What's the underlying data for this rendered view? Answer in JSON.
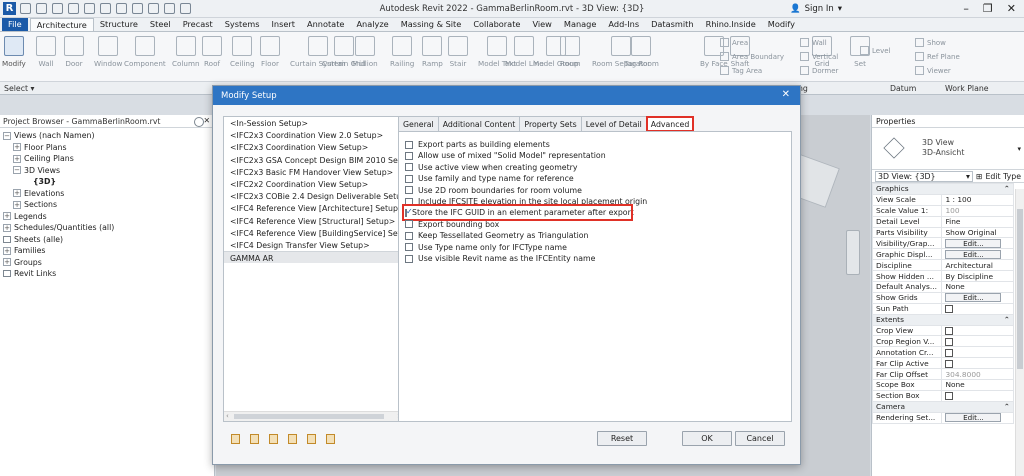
{
  "app": {
    "title": "Autodesk Revit 2022 - GammaBerlinRoom.rvt - 3D View: {3D}",
    "logo_letter": "R",
    "sign_in": "Sign In"
  },
  "ribbon": {
    "tabs": [
      "File",
      "Architecture",
      "Structure",
      "Steel",
      "Precast",
      "Systems",
      "Insert",
      "Annotate",
      "Analyze",
      "Massing & Site",
      "Collaborate",
      "View",
      "Manage",
      "Add-Ins",
      "Datasmith",
      "Rhino.Inside",
      "Modify"
    ],
    "active_tab": "Architecture",
    "buttons": [
      "Modify",
      "Wall",
      "Door",
      "Window",
      "Component",
      "Column",
      "Roof",
      "Ceiling",
      "Floor",
      "Curtain System",
      "Curtain Grid",
      "Mullion",
      "Railing",
      "Ramp",
      "Stair",
      "Model Text",
      "Model Line",
      "Model Group",
      "Room",
      "Room Separator",
      "Tag Room",
      "By Face",
      "Shaft",
      "Grid",
      "Set"
    ],
    "small_buttons": [
      "Area",
      "Area Boundary",
      "Tag Area",
      "Wall",
      "Vertical",
      "Dormer",
      "Level",
      "Show",
      "Ref Plane",
      "Viewer"
    ],
    "panel_labels": {
      "select": "Select ▾",
      "opening": "Opening",
      "datum": "Datum",
      "work_plane": "Work Plane"
    }
  },
  "project_browser": {
    "title": "Project Browser - GammaBerlinRoom.rvt",
    "nodes": [
      {
        "label": "Views (nach Namen)",
        "level": 0,
        "exp": "−"
      },
      {
        "label": "Floor Plans",
        "level": 1,
        "exp": "+"
      },
      {
        "label": "Ceiling Plans",
        "level": 1,
        "exp": "+"
      },
      {
        "label": "3D Views",
        "level": 1,
        "exp": "−"
      },
      {
        "label": "{3D}",
        "level": 3,
        "exp": "",
        "bold": true
      },
      {
        "label": "Elevations",
        "level": 1,
        "exp": "+"
      },
      {
        "label": "Sections",
        "level": 1,
        "exp": "+"
      },
      {
        "label": "Legends",
        "level": 0,
        "exp": "+"
      },
      {
        "label": "Schedules/Quantities (all)",
        "level": 0,
        "exp": "+"
      },
      {
        "label": "Sheets (alle)",
        "level": 0,
        "exp": ""
      },
      {
        "label": "Families",
        "level": 0,
        "exp": "+"
      },
      {
        "label": "Groups",
        "level": 0,
        "exp": "+"
      },
      {
        "label": "Revit Links",
        "level": 0,
        "exp": ""
      }
    ]
  },
  "dialog": {
    "title": "Modify Setup",
    "setups": [
      "<In-Session Setup>",
      "<IFC2x3 Coordination View 2.0 Setup>",
      "<IFC2x3 Coordination View Setup>",
      "<IFC2x3 GSA Concept Design BIM 2010 Setup>",
      "<IFC2x3 Basic FM Handover View Setup>",
      "<IFC2x2 Coordination View Setup>",
      "<IFC2x3 COBie 2.4 Design Deliverable Setup>",
      "<IFC4 Reference View [Architecture] Setup>",
      "<IFC4 Reference View [Structural] Setup>",
      "<IFC4 Reference View [BuildingService] Setup>",
      "<IFC4 Design Transfer View Setup>",
      "GAMMA AR"
    ],
    "selected_setup": "GAMMA AR",
    "tabs": [
      "General",
      "Additional Content",
      "Property Sets",
      "Level of Detail",
      "Advanced"
    ],
    "active_tab": "Advanced",
    "options": [
      {
        "label": "Export parts as building elements",
        "checked": false
      },
      {
        "label": "Allow use of mixed \"Solid Model\" representation",
        "checked": false
      },
      {
        "label": "Use active view when creating geometry",
        "checked": false
      },
      {
        "label": "Use family and type name for reference",
        "checked": false
      },
      {
        "label": "Use 2D room boundaries for room volume",
        "checked": false
      },
      {
        "label": "Include IFCSITE elevation in the site local placement origin",
        "checked": false
      },
      {
        "label": "Store the IFC GUID in an element parameter after export",
        "checked": true,
        "highlight": true
      },
      {
        "label": "Export bounding box",
        "checked": false
      },
      {
        "label": "Keep Tessellated Geometry as Triangulation",
        "checked": false
      },
      {
        "label": "Use Type name only for IFCType name",
        "checked": false
      },
      {
        "label": "Use visible Revit name as the IFCEntity name",
        "checked": false
      }
    ],
    "buttons": {
      "reset": "Reset",
      "ok": "OK",
      "cancel": "Cancel"
    }
  },
  "properties": {
    "title": "Properties",
    "type_line1": "3D View",
    "type_line2": "3D-Ansicht",
    "selector": "3D View: {3D}",
    "edit_type": "Edit Type",
    "rows": [
      {
        "k": "Graphics",
        "group": true
      },
      {
        "k": "View Scale",
        "v": "1 : 100"
      },
      {
        "k": "Scale Value    1:",
        "v": "100",
        "gray": true
      },
      {
        "k": "Detail Level",
        "v": "Fine"
      },
      {
        "k": "Parts Visibility",
        "v": "Show Original"
      },
      {
        "k": "Visibility/Grap...",
        "btn": "Edit..."
      },
      {
        "k": "Graphic Displ...",
        "btn": "Edit..."
      },
      {
        "k": "Discipline",
        "v": "Architectural"
      },
      {
        "k": "Show Hidden ...",
        "v": "By Discipline"
      },
      {
        "k": "Default Analys...",
        "v": "None"
      },
      {
        "k": "Show Grids",
        "btn": "Edit..."
      },
      {
        "k": "Sun Path",
        "chk": true
      },
      {
        "k": "Extents",
        "group": true
      },
      {
        "k": "Crop View",
        "chk": true
      },
      {
        "k": "Crop Region V...",
        "chk": true
      },
      {
        "k": "Annotation Cr...",
        "chk": true
      },
      {
        "k": "Far Clip Active",
        "chk": true
      },
      {
        "k": "Far Clip Offset",
        "v": "304.8000",
        "gray": true
      },
      {
        "k": "Scope Box",
        "v": "None"
      },
      {
        "k": "Section Box",
        "chk": true
      },
      {
        "k": "Camera",
        "group": true
      },
      {
        "k": "Rendering Set...",
        "btn": "Edit..."
      }
    ]
  }
}
